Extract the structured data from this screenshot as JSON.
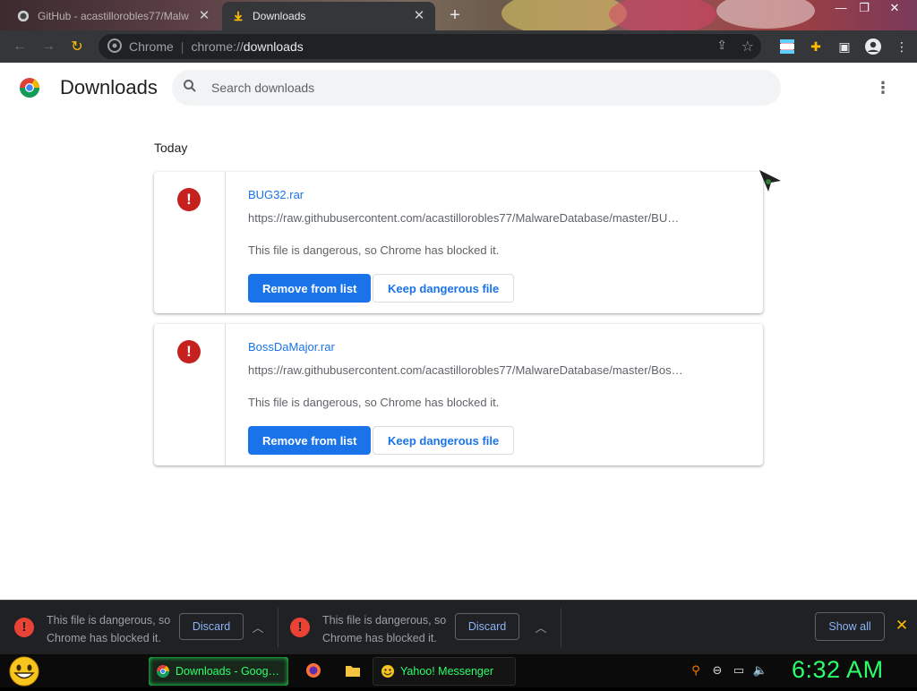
{
  "tabs": [
    {
      "title": "GitHub - acastillorobles77/Malw",
      "active": false
    },
    {
      "title": "Downloads",
      "active": true
    }
  ],
  "omnibox": {
    "scheme_label": "Chrome",
    "url_prefix": "chrome://",
    "url_host": "downloads"
  },
  "header": {
    "title": "Downloads",
    "search_placeholder": "Search downloads"
  },
  "date_label": "Today",
  "downloads": [
    {
      "filename": "BUG32.rar",
      "url": "https://raw.githubusercontent.com/acastillorobles77/MalwareDatabase/master/BU…",
      "description": "This file is dangerous, so Chrome has blocked it.",
      "remove_label": "Remove from list",
      "keep_label": "Keep dangerous file"
    },
    {
      "filename": "BossDaMajor.rar",
      "url": "https://raw.githubusercontent.com/acastillorobles77/MalwareDatabase/master/Bos…",
      "description": "This file is dangerous, so Chrome has blocked it.",
      "remove_label": "Remove from list",
      "keep_label": "Keep dangerous file"
    }
  ],
  "shelf": {
    "items": [
      {
        "message": "This file is dangerous, so Chrome has blocked it.",
        "discard_label": "Discard"
      },
      {
        "message": "This file is dangerous, so Chrome has blocked it.",
        "discard_label": "Discard"
      }
    ],
    "show_all_label": "Show all"
  },
  "taskbar": {
    "tasks": [
      {
        "label": "Downloads - Google…",
        "icon": "chrome-icon"
      },
      {
        "label": "Yahoo! Messenger",
        "icon": "yahoo-messenger-icon"
      }
    ],
    "clock": "6:32 AM"
  },
  "icons": {
    "danger": "exclamation-circle-icon",
    "search": "search-icon",
    "menu": "kebab-menu-icon"
  },
  "colors": {
    "accent": "#1a73e8",
    "danger": "#c5221f",
    "taskbar_text": "#2cff6a"
  }
}
